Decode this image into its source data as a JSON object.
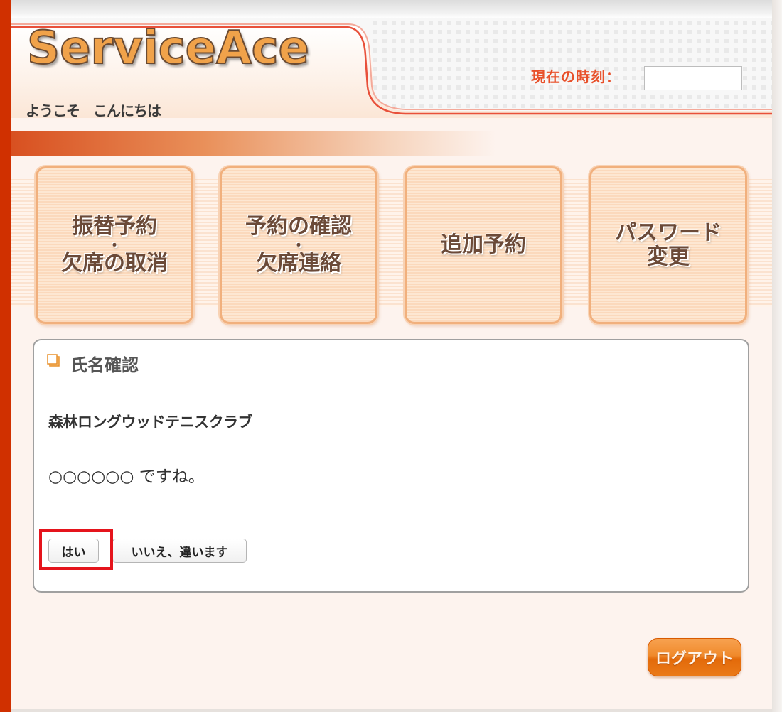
{
  "header": {
    "logo_text": "ServiceAce",
    "welcome_text": "ようこそ　こんにちは",
    "clock_label": "現在の時刻：",
    "clock_value": ""
  },
  "menu": [
    {
      "line1": "振替予約",
      "dot": "・",
      "line2": "欠席の取消"
    },
    {
      "line1": "予約の確認",
      "dot": "・",
      "line2": "欠席連絡"
    },
    {
      "line1": "追加予約",
      "dot": "",
      "line2": ""
    },
    {
      "line1": "パスワード",
      "dot": "",
      "line2": "変更"
    }
  ],
  "panel": {
    "title": "氏名確認",
    "club_name": "森林ロングウッドテニスクラブ",
    "confirm_text": "○○○○○○ ですね。",
    "yes_label": "はい",
    "no_label": "いいえ、違います"
  },
  "logout_label": "ログアウト",
  "colors": {
    "accent": "#d03000",
    "clock_label": "#e8502a",
    "highlight": "#e5141c",
    "logout": "#f08a2c"
  }
}
